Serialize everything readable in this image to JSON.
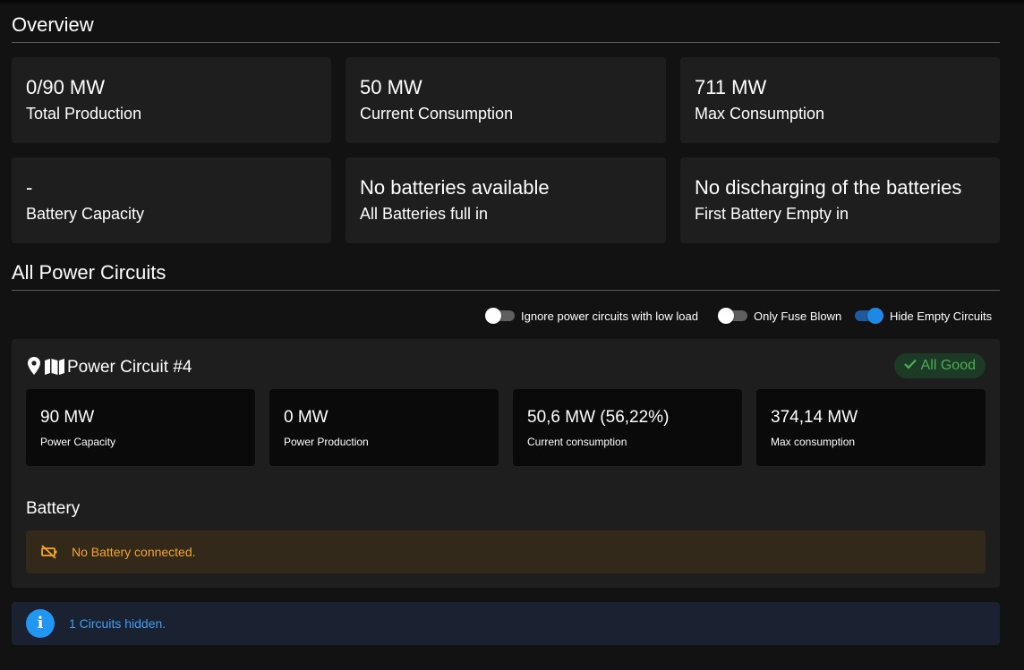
{
  "overview": {
    "title": "Overview",
    "cards": [
      {
        "value": "0/90 MW",
        "label": "Total Production"
      },
      {
        "value": "50 MW",
        "label": "Current Consumption"
      },
      {
        "value": "711 MW",
        "label": "Max Consumption"
      },
      {
        "value": "-",
        "label": "Battery Capacity"
      },
      {
        "value": "No batteries available",
        "label": "All Batteries full in"
      },
      {
        "value": "No discharging of the batteries",
        "label": "First Battery Empty in"
      }
    ]
  },
  "circuits": {
    "title": "All Power Circuits",
    "filters": [
      {
        "label": "Ignore power circuits with low load",
        "enabled": false
      },
      {
        "label": "Only Fuse Blown",
        "enabled": false
      },
      {
        "label": "Hide Empty Circuits",
        "enabled": true
      }
    ],
    "items": [
      {
        "icons": [
          "map-marker-icon",
          "map-icon"
        ],
        "title": "Power Circuit #4",
        "status": {
          "label": "All Good",
          "icon": "check-icon",
          "color": "#4caf50"
        },
        "stats": [
          {
            "value": "90 MW",
            "label": "Power Capacity"
          },
          {
            "value": "0 MW",
            "label": "Power Production"
          },
          {
            "value": "50,6 MW (56,22%)",
            "label": "Current consumption"
          },
          {
            "value": "374,14 MW",
            "label": "Max consumption"
          }
        ],
        "battery": {
          "title": "Battery",
          "alert": {
            "icon": "battery-off-icon",
            "text": "No Battery connected.",
            "color": "#f5a623"
          }
        }
      }
    ],
    "hidden_info": {
      "icon": "info-icon",
      "text": "1 Circuits hidden.",
      "color": "#2196f3"
    }
  },
  "colors": {
    "background": "#121212",
    "card": "#1e1e1e",
    "accent": "#1e88e5",
    "success": "#4caf50",
    "warning": "#f5a623"
  }
}
